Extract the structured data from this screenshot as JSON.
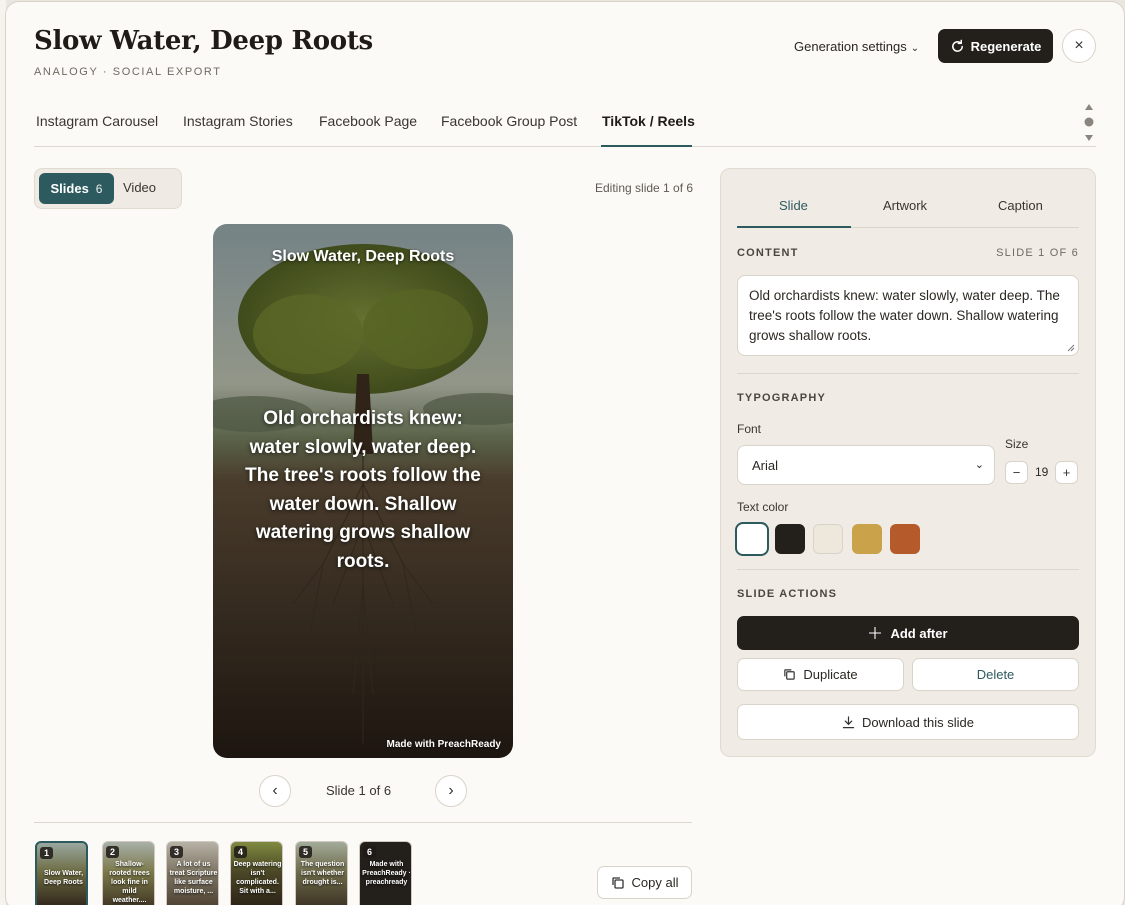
{
  "header": {
    "title": "Slow Water, Deep Roots",
    "subtitle": "ANALOGY · SOCIAL EXPORT",
    "generation_settings": "Generation settings",
    "regenerate": "Regenerate",
    "close": "×"
  },
  "tabs": [
    {
      "label": "Instagram Carousel"
    },
    {
      "label": "Instagram Stories"
    },
    {
      "label": "Facebook Page"
    },
    {
      "label": "Facebook Group Post"
    },
    {
      "label": "TikTok / Reels",
      "active": true
    }
  ],
  "mode": {
    "slides_label": "Slides",
    "slides_count": "6",
    "video_label": "Video",
    "editing_text": "Editing slide 1 of 6"
  },
  "preview": {
    "title": "Slow Water, Deep Roots",
    "body": "Old orchardists knew: water slowly, water deep. The tree's roots follow the water down. Shallow watering grows shallow roots.",
    "watermark": "Made with PreachReady",
    "prev": "‹",
    "next": "›",
    "counter": "Slide 1 of 6"
  },
  "thumbnails": [
    {
      "num": "1",
      "text": "Slow Water, Deep Roots"
    },
    {
      "num": "2",
      "text": "Shallow-rooted trees look fine in mild weather...."
    },
    {
      "num": "3",
      "text": "A lot of us treat Scripture like surface moisture, ..."
    },
    {
      "num": "4",
      "text": "Deep watering isn't complicated. Sit with a..."
    },
    {
      "num": "5",
      "text": "The question isn't whether drought is..."
    },
    {
      "num": "6",
      "text": "Made with PreachReady · preachready"
    }
  ],
  "copy_all": "Copy all",
  "panel": {
    "tabs": [
      "Slide",
      "Artwork",
      "Caption"
    ],
    "content_label": "CONTENT",
    "content_slide": "SLIDE 1 OF 6",
    "content_text": "Old orchardists knew: water slowly, water deep. The tree's roots follow the water down. Shallow watering grows shallow roots.",
    "typography_label": "TYPOGRAPHY",
    "font_label": "Font",
    "font_value": "Arial",
    "size_label": "Size",
    "size_value": "19",
    "minus": "−",
    "plus": "+",
    "text_color_label": "Text color",
    "colors": [
      "#ffffff",
      "#231f1b",
      "#eee8dc",
      "#c9a24a",
      "#b45a2b"
    ],
    "actions_label": "SLIDE ACTIONS",
    "add_after": "Add after",
    "duplicate": "Duplicate",
    "delete": "Delete",
    "download": "Download this slide"
  },
  "accent_color": "#2d5a5e"
}
